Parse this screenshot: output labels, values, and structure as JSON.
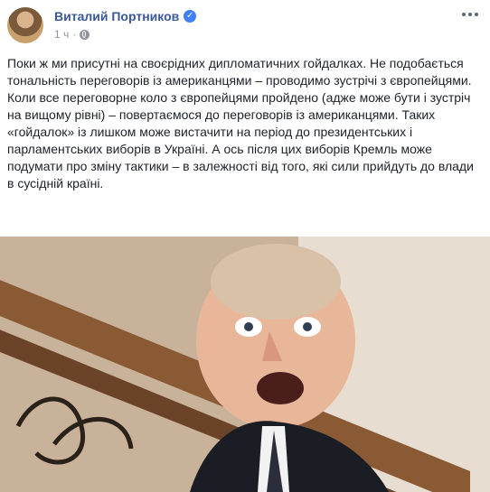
{
  "post": {
    "author_name": "Виталий Портников",
    "timestamp": "1 ч",
    "icons": {
      "verified": "verified-badge-icon",
      "audience": "globe-icon",
      "options": "more-options-icon"
    },
    "text": "Поки ж ми присутні на своєрідних дипломатичних гойдалках. Не подобається тональність переговорів із американцями – проводимо зустрічі з європейцями. Коли все переговорне коло з європейцями пройдено (адже може бути і зустріч на вищому рівні) – повертаємося до переговорів із американцями. Таких «гойдалок» із лишком може вистачити на період до президентських і парламентських виборів в Україні. А ось після цих виборів Кремль може подумати про зміну тактики – в залежності від того, які сили прийдуть до влади в сусідній країні."
  },
  "colors": {
    "author_link": "#385898",
    "body_text": "#1d2129",
    "meta_text": "#90949c",
    "verified": "#4080ff"
  }
}
